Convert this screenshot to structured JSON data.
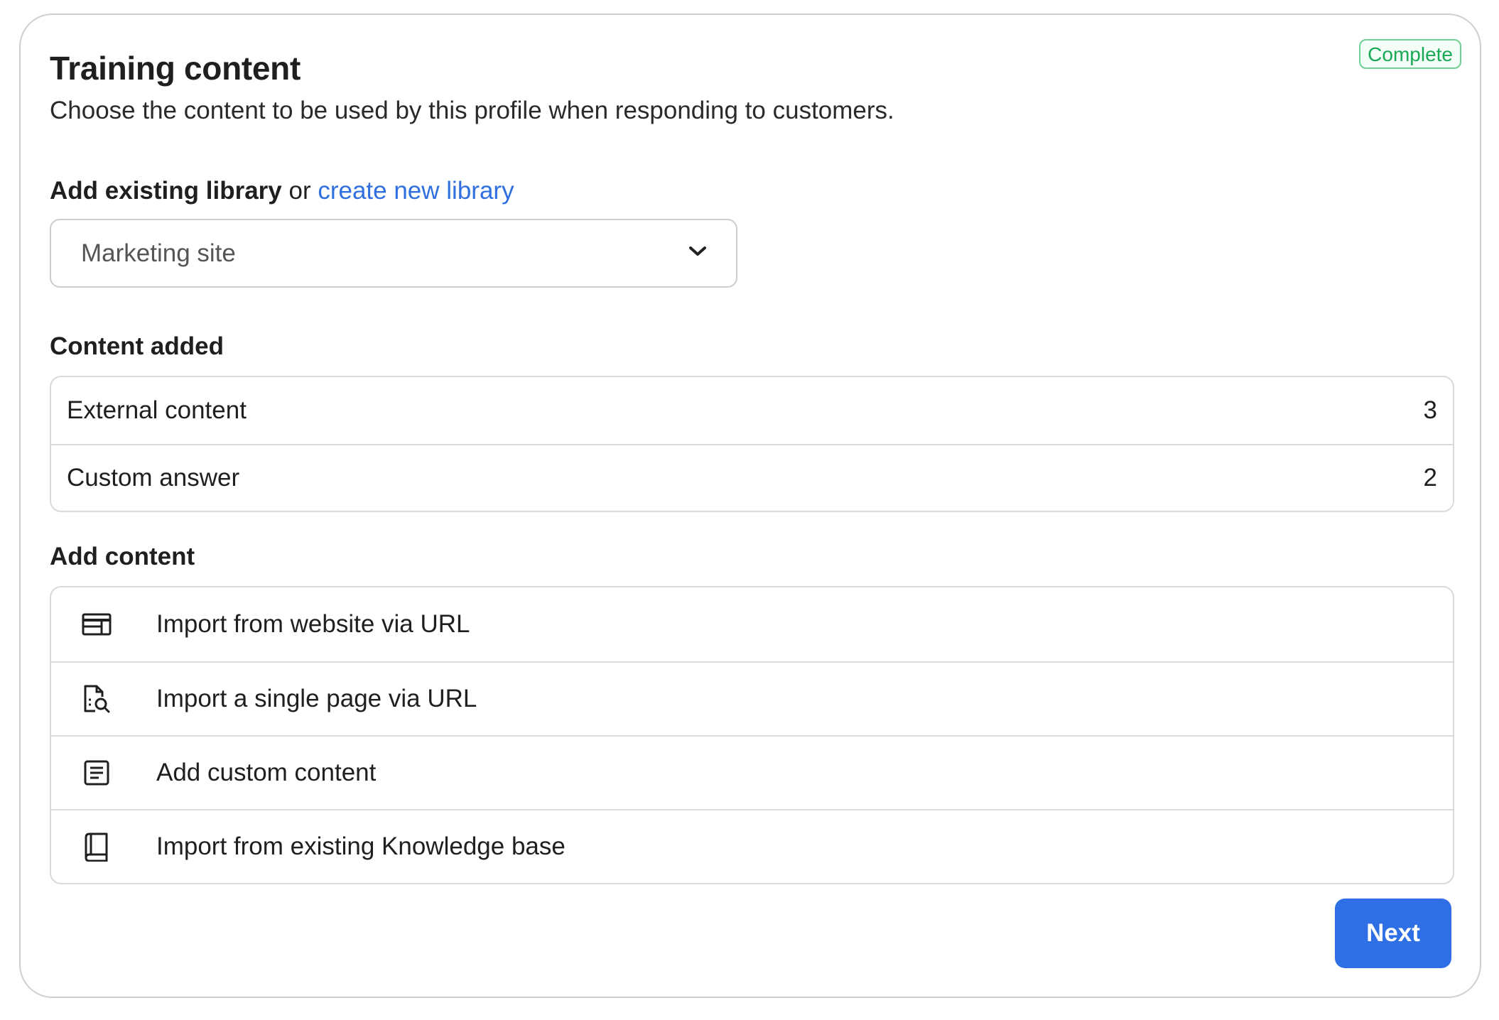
{
  "status_badge": "Complete",
  "header": {
    "title": "Training content",
    "subtitle": "Choose the content to be used by this profile when responding to customers."
  },
  "library": {
    "label": "Add existing library",
    "or_text": "or",
    "create_link": "create new library",
    "selected": "Marketing site"
  },
  "content_added": {
    "title": "Content added",
    "rows": [
      {
        "label": "External content",
        "count": "3"
      },
      {
        "label": "Custom answer",
        "count": "2"
      }
    ]
  },
  "add_content": {
    "title": "Add content",
    "actions": [
      {
        "label": "Import from website via URL",
        "icon": "browser-window-icon"
      },
      {
        "label": "Import a single page via URL",
        "icon": "document-search-icon"
      },
      {
        "label": "Add custom content",
        "icon": "document-lines-icon"
      },
      {
        "label": "Import from existing Knowledge base",
        "icon": "book-icon"
      }
    ]
  },
  "footer": {
    "next_label": "Next"
  },
  "colors": {
    "accent": "#2e6fe6",
    "link": "#2f6fde",
    "success": "#1aa957"
  }
}
